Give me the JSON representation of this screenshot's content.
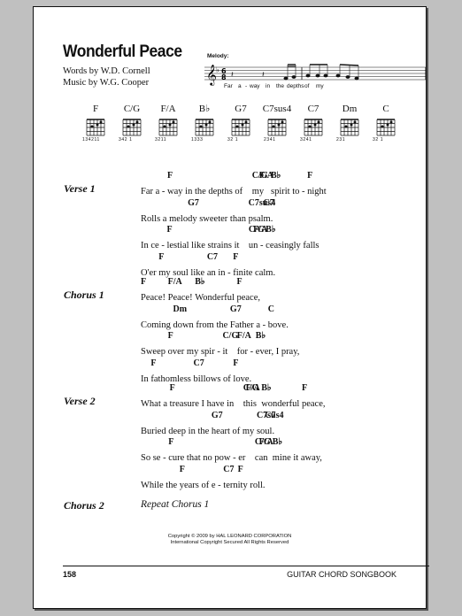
{
  "song": {
    "title": "Wonderful Peace",
    "words_by": "Words by W.D. Cornell",
    "music_by": "Music by W.G. Cooper"
  },
  "melody": {
    "label": "Melody:",
    "lyrics": [
      "Far",
      "a",
      "-",
      "way",
      "in",
      "the",
      "depths",
      "of",
      "my"
    ]
  },
  "chord_diagrams": [
    {
      "name": "F",
      "fingers": "134211"
    },
    {
      "name": "C/G",
      "fingers": "342 1"
    },
    {
      "name": "F/A",
      "fingers": "3211"
    },
    {
      "name": "B♭",
      "fingers": "1333"
    },
    {
      "name": "G7",
      "fingers": "32    1"
    },
    {
      "name": "C7sus4",
      "fingers": "2341"
    },
    {
      "name": "C7",
      "fingers": "3241"
    },
    {
      "name": "Dm",
      "fingers": "231"
    },
    {
      "name": "C",
      "fingers": "32 1"
    }
  ],
  "sections": [
    {
      "label": "Verse 1",
      "lines": [
        [
          {
            "c": "",
            "t": "Far a - "
          },
          {
            "c": "F",
            "t": "way in the depths of    "
          },
          {
            "c": "C/G",
            "t": "m"
          },
          {
            "c": "F/A",
            "t": "y   "
          },
          {
            "c": "B♭",
            "t": "spirit to - "
          },
          {
            "c": "F",
            "t": "night"
          }
        ],
        [
          {
            "c": "",
            "t": "Rolls a melo"
          },
          {
            "c": "G7",
            "t": "dy sweeter than "
          },
          {
            "c": "C7sus4",
            "t": "psal"
          },
          {
            "c": "C7",
            "t": "m."
          }
        ],
        [
          {
            "c": "",
            "t": "In ce - "
          },
          {
            "c": "F",
            "t": "lestial like strains it    "
          },
          {
            "c": "C/G",
            "t": "u"
          },
          {
            "c": "F/A",
            "t": "n - "
          },
          {
            "c": "B♭",
            "t": "ceasingly falls"
          }
        ],
        [
          {
            "c": "",
            "t": "O'er "
          },
          {
            "c": "F",
            "t": "my soul like "
          },
          {
            "c": "C7",
            "t": "an in - "
          },
          {
            "c": "F",
            "t": "finite calm."
          }
        ]
      ]
    },
    {
      "label": "Chorus 1",
      "lines": [
        [
          {
            "c": "F",
            "t": "Peace! "
          },
          {
            "c": "F/A",
            "t": "Peace! "
          },
          {
            "c": "B♭",
            "t": "Wonderful "
          },
          {
            "c": "F",
            "t": "peace,"
          }
        ],
        [
          {
            "c": "",
            "t": "Coming "
          },
          {
            "c": "Dm",
            "t": "down from the "
          },
          {
            "c": "G7",
            "t": "Father a - "
          },
          {
            "c": "C",
            "t": "bove."
          }
        ],
        [
          {
            "c": "",
            "t": "Sweep "
          },
          {
            "c": "F",
            "t": "over my spir - "
          },
          {
            "c": "C/G",
            "t": "it    "
          },
          {
            "c": "F/A",
            "t": "for - "
          },
          {
            "c": "B♭",
            "t": "ever, I pray,"
          }
        ],
        [
          {
            "c": "",
            "t": "In "
          },
          {
            "c": "F",
            "t": "fathomless "
          },
          {
            "c": "C7",
            "t": "billows of "
          },
          {
            "c": "F",
            "t": "love."
          }
        ]
      ]
    },
    {
      "label": "Verse 2",
      "lines": [
        [
          {
            "c": "",
            "t": "What a "
          },
          {
            "c": "F",
            "t": "treasure I have in    "
          },
          {
            "c": "C/G",
            "t": "t"
          },
          {
            "c": "F/A",
            "t": "his  "
          },
          {
            "c": "B♭",
            "t": "wonderful "
          },
          {
            "c": "F",
            "t": "peace,"
          }
        ],
        [
          {
            "c": "",
            "t": "Buried deep in the "
          },
          {
            "c": "G7",
            "t": "heart of my "
          },
          {
            "c": "C7sus4",
            "t": "so"
          },
          {
            "c": "C7",
            "t": "ul."
          }
        ],
        [
          {
            "c": "",
            "t": "So se - "
          },
          {
            "c": "F",
            "t": "cure that no pow - er    "
          },
          {
            "c": "C/G",
            "t": "c"
          },
          {
            "c": "F/A",
            "t": "an  "
          },
          {
            "c": "B♭",
            "t": "mine it away,"
          }
        ],
        [
          {
            "c": "",
            "t": "While the "
          },
          {
            "c": "F",
            "t": "years of e - "
          },
          {
            "c": "C7",
            "t": "tern"
          },
          {
            "c": "F",
            "t": "ity roll."
          }
        ]
      ]
    },
    {
      "label": "Chorus 2",
      "repeat": "Repeat Chorus 1"
    }
  ],
  "copyright": {
    "line1": "Copyright © 2009 by HAL LEONARD CORPORATION",
    "line2": "International Copyright Secured   All Rights Reserved"
  },
  "footer": {
    "page_number": "158",
    "book_title": "GUITAR CHORD SONGBOOK"
  }
}
